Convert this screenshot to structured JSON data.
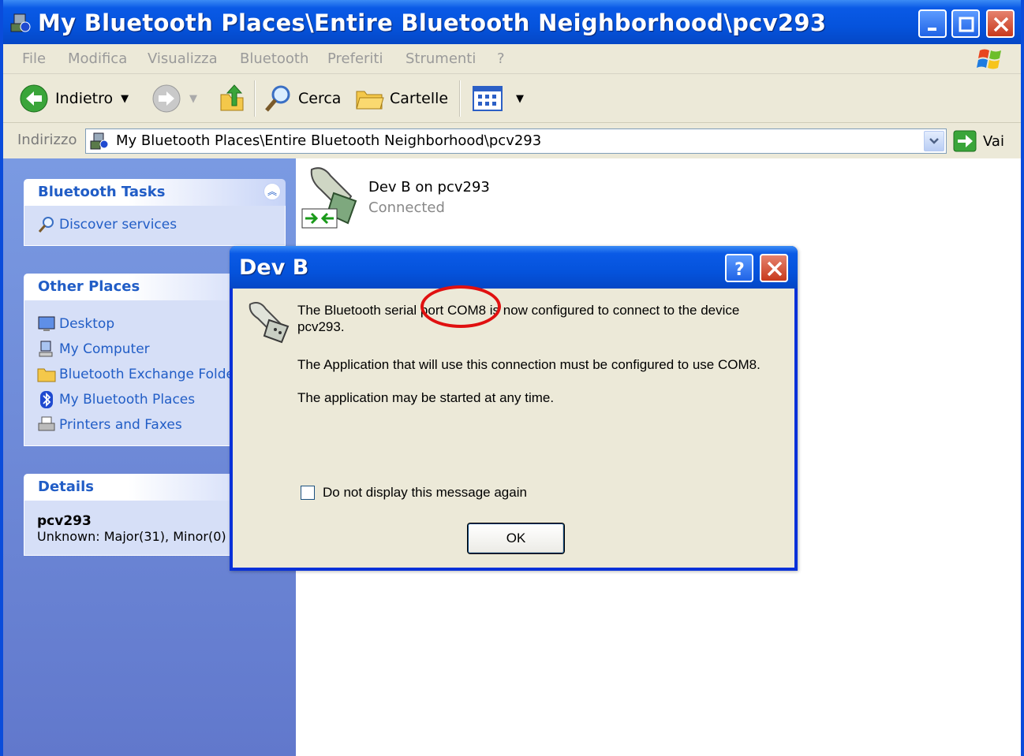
{
  "window": {
    "title": "My Bluetooth Places\\Entire Bluetooth Neighborhood\\pcv293"
  },
  "menubar": {
    "items": [
      "File",
      "Modifica",
      "Visualizza",
      "Bluetooth",
      "Preferiti",
      "Strumenti",
      "?"
    ]
  },
  "toolbar": {
    "back_label": "Indietro",
    "search_label": "Cerca",
    "folders_label": "Cartelle"
  },
  "addressbar": {
    "label": "Indirizzo",
    "value": "My Bluetooth Places\\Entire Bluetooth Neighborhood\\pcv293",
    "go_label": "Vai"
  },
  "sidebar": {
    "bluetooth_tasks": {
      "title": "Bluetooth Tasks",
      "items": [
        "Discover services"
      ]
    },
    "other_places": {
      "title": "Other Places",
      "items": [
        "Desktop",
        "My Computer",
        "Bluetooth Exchange Folder",
        "My Bluetooth Places",
        "Printers and Faxes"
      ]
    },
    "details": {
      "title": "Details",
      "name": "pcv293",
      "info": "Unknown: Major(31), Minor(0)"
    }
  },
  "content": {
    "item_name": "Dev B on pcv293",
    "item_status": "Connected"
  },
  "dialog": {
    "title": "Dev B",
    "line1": "The Bluetooth serial port COM8 is now configured to connect to the device",
    "line2": "pcv293.",
    "line3": "The Application that will use this connection must be configured to use COM8.",
    "line4": "The application may be started at any time.",
    "checkbox_label": "Do not display this message again",
    "checkbox_checked": false,
    "ok_label": "OK"
  },
  "colors": {
    "titlebar": "#0553DC",
    "sidebar": "#6E8AD8",
    "link": "#215DC6",
    "highlight_circle": "#E01010"
  }
}
